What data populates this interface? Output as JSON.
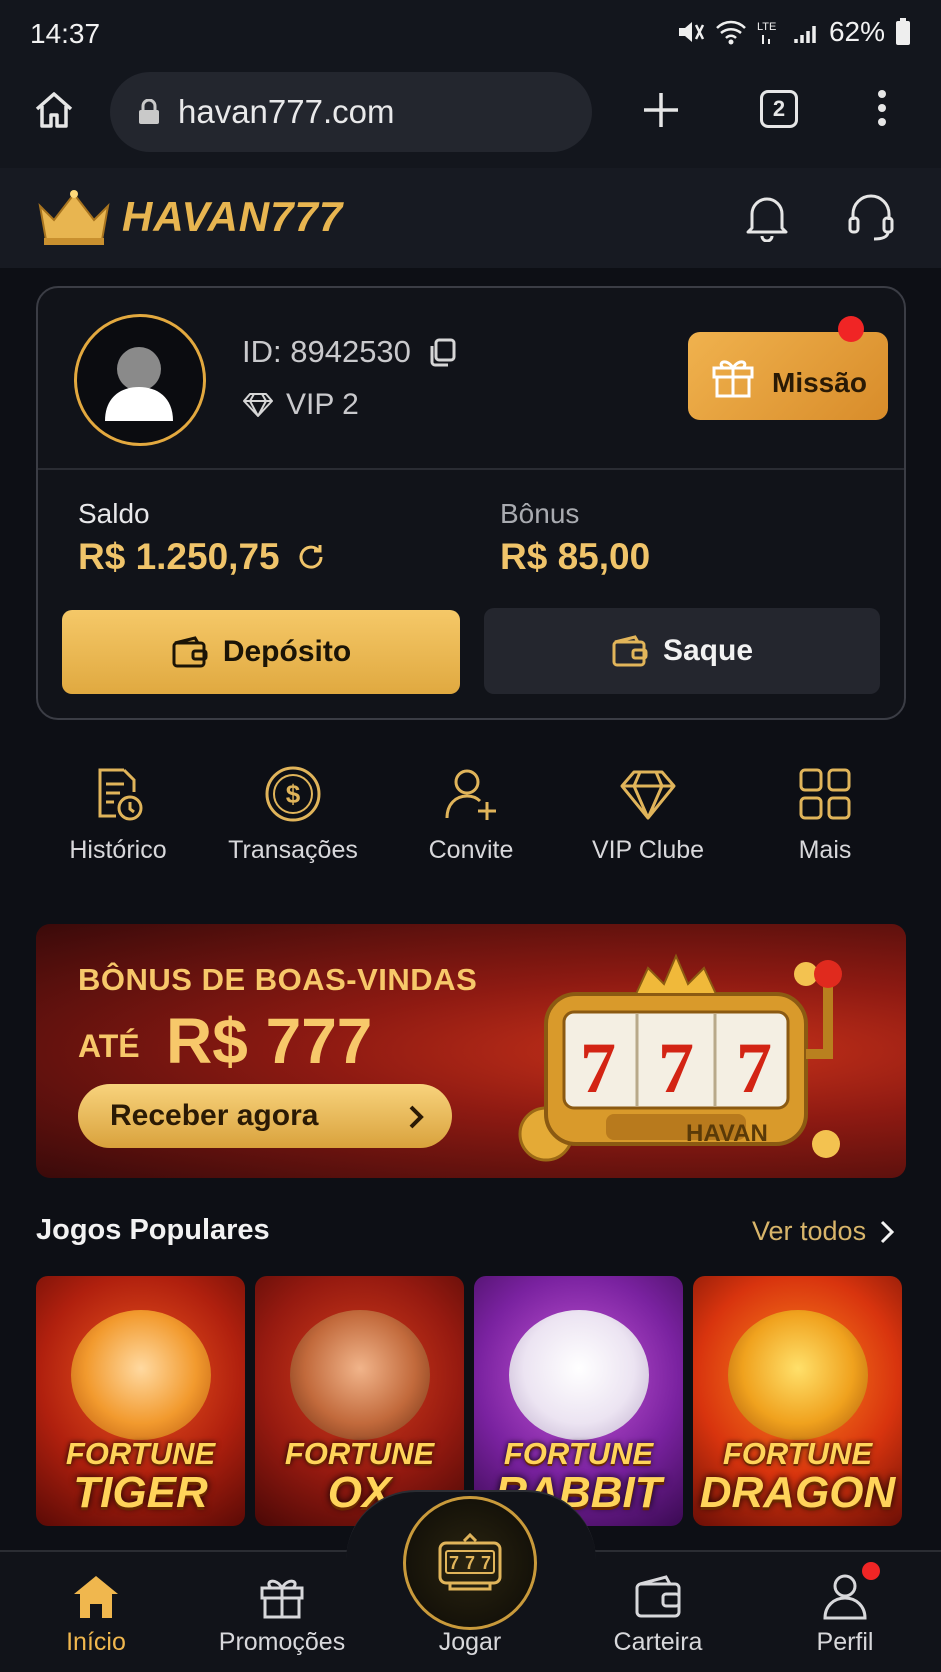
{
  "status_bar": {
    "time": "14:37",
    "battery": "62%"
  },
  "browser": {
    "url": "havan777.com",
    "tab_count": "2"
  },
  "header": {
    "logo_text": "HAVAN777"
  },
  "account": {
    "id_label": "ID: 8942530",
    "vip_label": "VIP 2",
    "mission_label": "Missão",
    "balance_label": "Saldo",
    "balance_value": "R$ 1.250,75",
    "bonus_label": "Bônus",
    "bonus_value": "R$ 85,00",
    "deposit_label": "Depósito",
    "withdraw_label": "Saque"
  },
  "quick_actions": [
    {
      "label": "Histórico",
      "icon": "history-doc-icon"
    },
    {
      "label": "Transações",
      "icon": "dollar-circle-icon"
    },
    {
      "label": "Convite",
      "icon": "add-user-icon"
    },
    {
      "label": "VIP Clube",
      "icon": "diamond-icon"
    },
    {
      "label": "Mais",
      "icon": "grid-icon"
    }
  ],
  "banner": {
    "line1": "BÔNUS DE BOAS-VINDAS",
    "line2_prefix": "ATÉ",
    "line2_amount": "R$ 777",
    "cta": "Receber agora",
    "slot_label": "HAVAN"
  },
  "popular": {
    "title": "Jogos Populares",
    "see_all": "Ver todos",
    "games": [
      {
        "line1": "FORTUNE",
        "line2": "TIGER"
      },
      {
        "line1": "FORTUNE",
        "line2": "OX"
      },
      {
        "line1": "FORTUNE",
        "line2": "RABBIT"
      },
      {
        "line1": "FORTUNE",
        "line2": "DRAGON"
      }
    ]
  },
  "bottom_nav": {
    "home": "Início",
    "promos": "Promoções",
    "play": "Jogar",
    "wallet": "Carteira",
    "profile": "Perfil"
  },
  "colors": {
    "accent": "#f0b74e",
    "background": "#0d0f15",
    "notification": "#f02525"
  }
}
